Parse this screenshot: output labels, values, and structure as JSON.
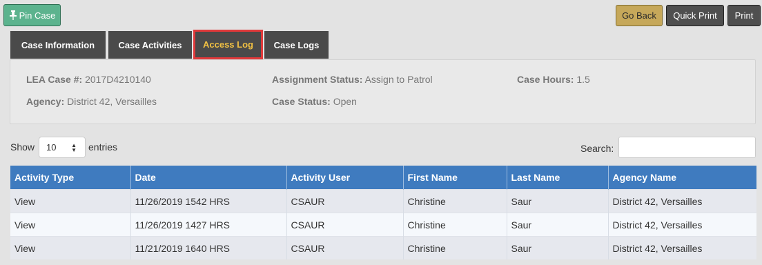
{
  "toolbar": {
    "pin_label": "Pin Case",
    "go_back_label": "Go Back",
    "quick_print_label": "Quick Print",
    "print_label": "Print"
  },
  "tabs": [
    {
      "label": "Case Information",
      "active": false
    },
    {
      "label": "Case Activities",
      "active": false
    },
    {
      "label": "Access Log",
      "active": true
    },
    {
      "label": "Case Logs",
      "active": false
    }
  ],
  "case_info": {
    "lea_case_label": "LEA Case #:",
    "lea_case_value": "2017D4210140",
    "agency_label": "Agency:",
    "agency_value": "District 42, Versailles",
    "assignment_status_label": "Assignment Status:",
    "assignment_status_value": "Assign to Patrol",
    "case_status_label": "Case Status:",
    "case_status_value": "Open",
    "case_hours_label": "Case Hours:",
    "case_hours_value": "1.5"
  },
  "table_controls": {
    "show_label": "Show",
    "entries_value": "10",
    "entries_label": "entries",
    "search_label": "Search:",
    "search_value": ""
  },
  "table": {
    "columns": [
      "Activity Type",
      "Date",
      "Activity User",
      "First Name",
      "Last Name",
      "Agency Name"
    ],
    "rows": [
      [
        "View",
        "11/26/2019 1542 HRS",
        "CSAUR",
        "Christine",
        "Saur",
        "District 42, Versailles"
      ],
      [
        "View",
        "11/26/2019 1427 HRS",
        "CSAUR",
        "Christine",
        "Saur",
        "District 42, Versailles"
      ],
      [
        "View",
        "11/21/2019 1640 HRS",
        "CSAUR",
        "Christine",
        "Saur",
        "District 42, Versailles"
      ]
    ]
  },
  "colors": {
    "header_blue": "#3f7bbf",
    "tab_dark": "#4a4a4a",
    "active_tab_text": "#f0c043",
    "highlight_red": "#e0393a",
    "pin_green": "#5cb38e",
    "go_back_gold": "#c6a85a"
  }
}
